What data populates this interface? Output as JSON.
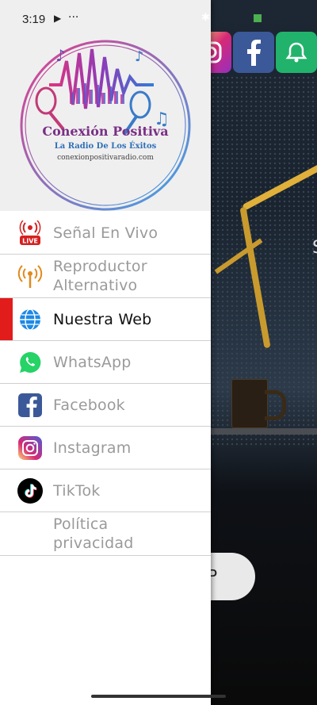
{
  "status_bar": {
    "time": "3:19",
    "play_glyph": "▶",
    "more_glyph": "···"
  },
  "logo": {
    "title": "Conexión Positiva",
    "subtitle": "La Radio De Los Éxitos",
    "url": "conexionpositivaradio.com"
  },
  "menu": [
    {
      "label": "Señal En Vivo",
      "icon": "live-radio-icon",
      "active": false
    },
    {
      "label": "Reproductor Alternativo",
      "icon": "antenna-icon",
      "active": false
    },
    {
      "label": "Nuestra Web",
      "icon": "globe-icon",
      "active": true
    },
    {
      "label": "WhatsApp",
      "icon": "whatsapp-icon",
      "active": false
    },
    {
      "label": "Facebook",
      "icon": "facebook-icon",
      "active": false
    },
    {
      "label": "Instagram",
      "icon": "instagram-icon",
      "active": false
    },
    {
      "label": "TikTok",
      "icon": "tiktok-icon",
      "active": false
    },
    {
      "label": "Política privacidad",
      "icon": "",
      "active": false
    }
  ],
  "background": {
    "partial_button_text": "P",
    "partial_side_text": "S"
  },
  "colors": {
    "active_indicator": "#e21b1b",
    "inactive_text": "#9a9a9a",
    "active_text": "#111111"
  }
}
